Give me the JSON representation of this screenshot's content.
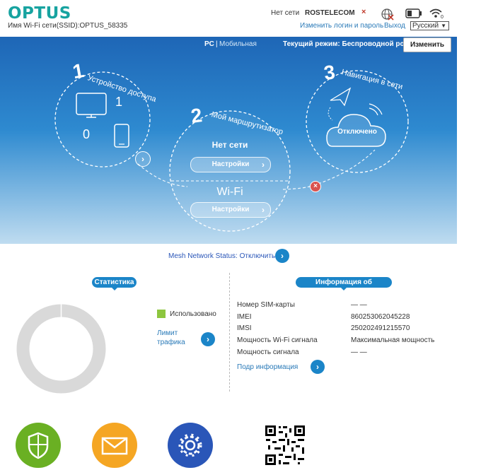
{
  "header": {
    "logo": "OPTUS",
    "ssid": "Имя Wi-Fi сети(SSID):OPTUS_58335",
    "network_status": "Нет сети",
    "operator": "ROSTELECOM",
    "no_signal_mark": "×",
    "change_login_link": "Изменить логин и пароль",
    "logout_link": "Выход",
    "language": "Русский"
  },
  "modebar": {
    "pc": "PC",
    "separator": "|",
    "mobile": "Мобильная",
    "current_mode": "Текущий режим: Беспроводной роутер",
    "change_button": "Изменить"
  },
  "steps": {
    "step1": {
      "number": "1",
      "title": "Устройство доступа",
      "pc_count": "1",
      "mobile_count": "0"
    },
    "step2": {
      "number": "2",
      "title": "Мой маршрутизатор",
      "net_status": "Нет сети",
      "net_settings": "Настройки",
      "wifi_label": "Wi-Fi",
      "wifi_settings": "Настройки"
    },
    "step3": {
      "number": "3",
      "title": "Навигация в сети",
      "cloud_status": "Отключено"
    }
  },
  "mesh": {
    "label": "Mesh Network Status: Отключить"
  },
  "stats": {
    "title": "Статистика",
    "legend_used": "Использовано",
    "limit_link_line1": "Лимит",
    "limit_link_line2": "трафика",
    "used_color": "#8dc63f"
  },
  "device_info": {
    "title": "Информация об устройстве",
    "rows": [
      {
        "label": "Номер SIM-карты",
        "value": "— —"
      },
      {
        "label": "IMEI",
        "value": "860253062045228"
      },
      {
        "label": "IMSI",
        "value": "250202491215570"
      },
      {
        "label": "Мощность Wi-Fi сигнала",
        "value": "Максимальная мощность"
      },
      {
        "label": "Мощность сигнала",
        "value": "— —"
      }
    ],
    "more_link": "Подр информация"
  },
  "bottom_icons": [
    "shield-icon",
    "mail-icon",
    "settings-gear-icon",
    "qr-code"
  ],
  "colors": {
    "brand": "#17a3a0",
    "accent": "#1b85c8",
    "error": "#d9534f",
    "green": "#6ab023",
    "orange": "#f5a623",
    "blue": "#2a56b8"
  }
}
